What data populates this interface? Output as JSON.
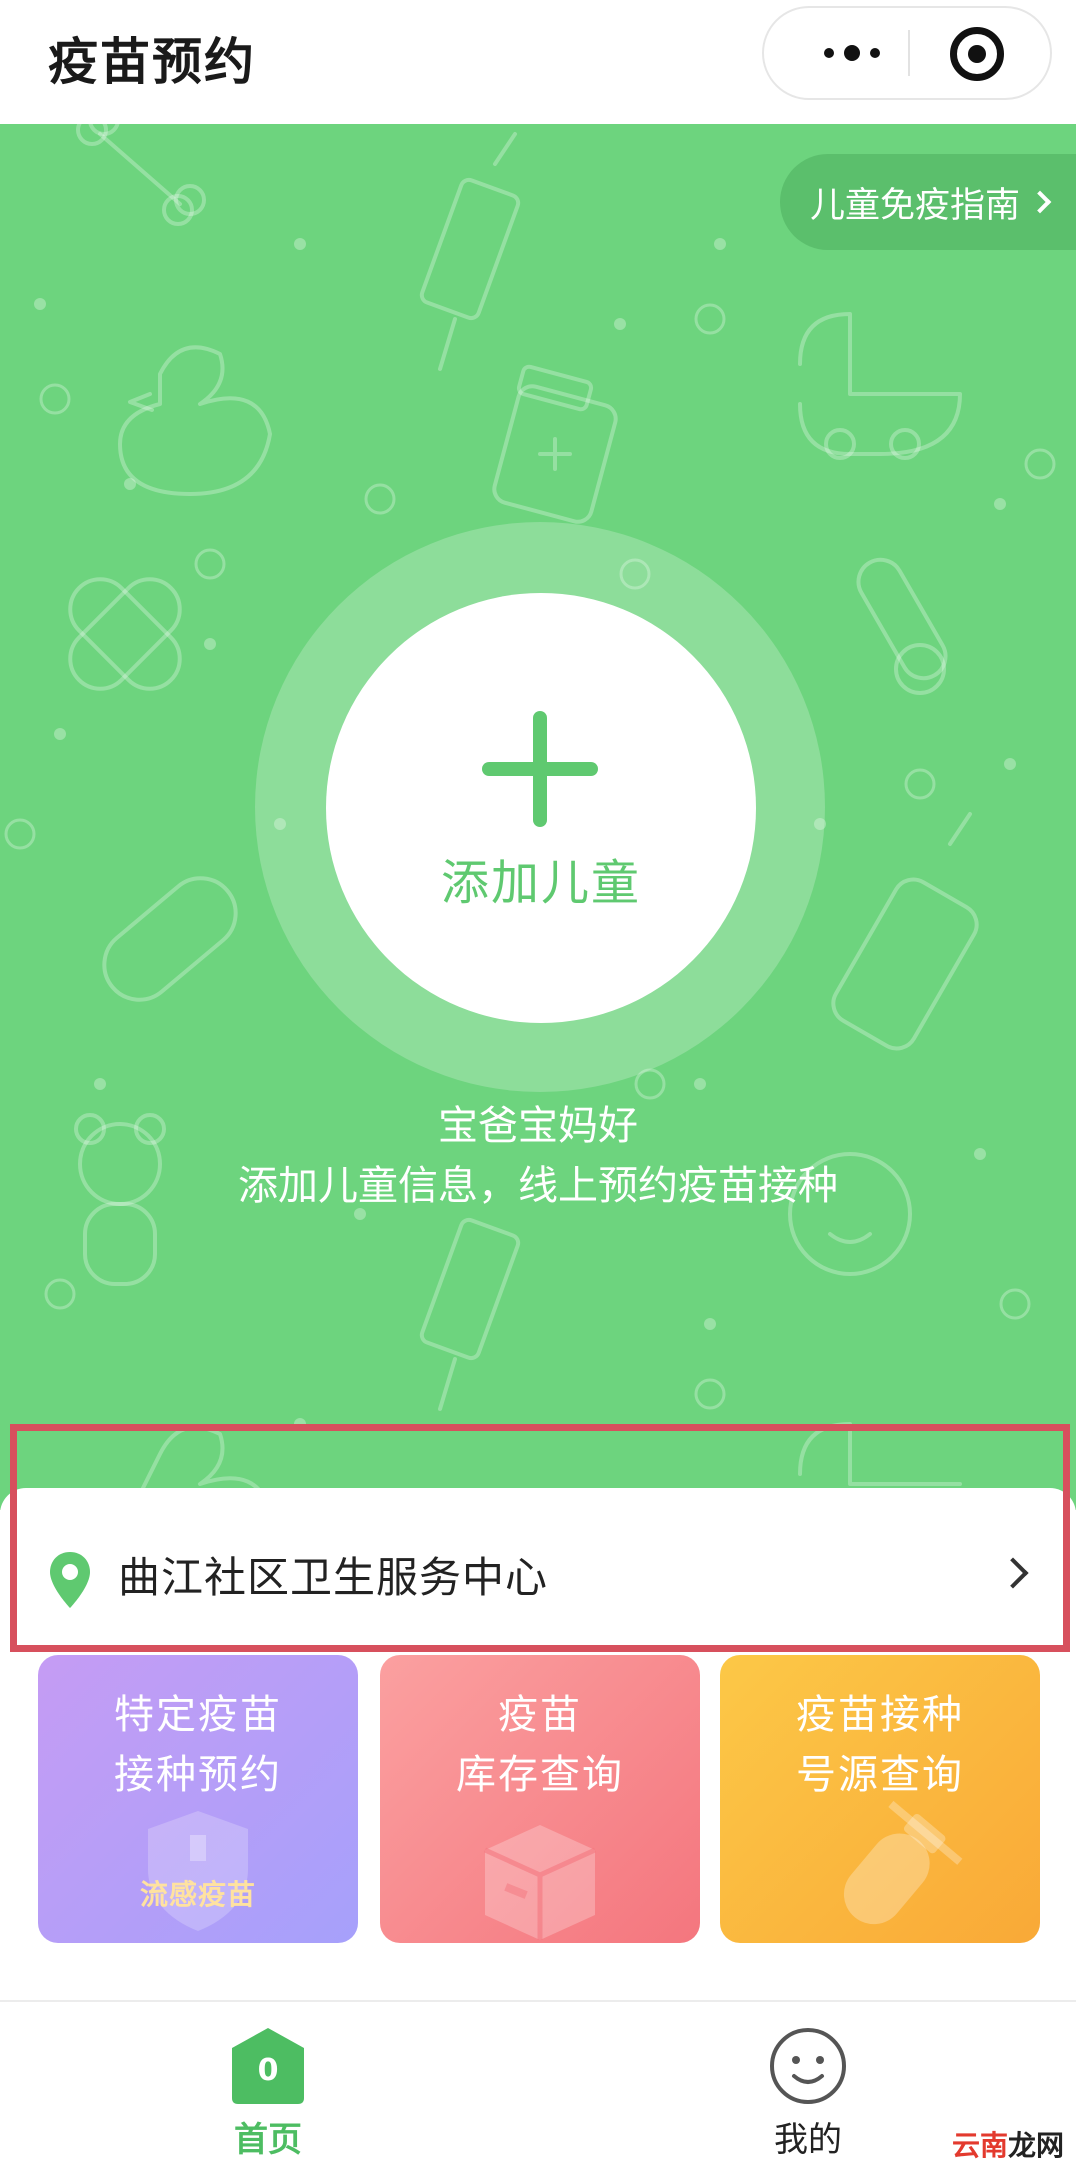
{
  "header": {
    "title": "疫苗预约",
    "more_icon": "more-dots-icon",
    "close_icon": "target-close-icon"
  },
  "hero": {
    "guide_label": "儿童免疫指南",
    "add_child_label": "添加儿童",
    "greeting_line1": "宝爸宝妈好",
    "greeting_line2": "添加儿童信息，线上预约疫苗接种",
    "background_color": "#6dd47e"
  },
  "location": {
    "name": "曲江社区卫生服务中心",
    "pin_icon": "location-pin-icon",
    "highlight_color": "#d7505d"
  },
  "tiles": [
    {
      "line1": "特定疫苗",
      "line2": "接种预约",
      "badge": "流感疫苗",
      "icon": "shield-icon"
    },
    {
      "line1": "疫苗",
      "line2": "库存查询",
      "icon": "box-icon"
    },
    {
      "line1": "疫苗接种",
      "line2": "号源查询",
      "icon": "vial-icon"
    }
  ],
  "tabbar": {
    "home_label": "首页",
    "home_badge": "0",
    "mine_label": "我的",
    "active_color": "#4dbd62"
  },
  "watermark": {
    "part1": "云南",
    "part2": "龙网"
  }
}
